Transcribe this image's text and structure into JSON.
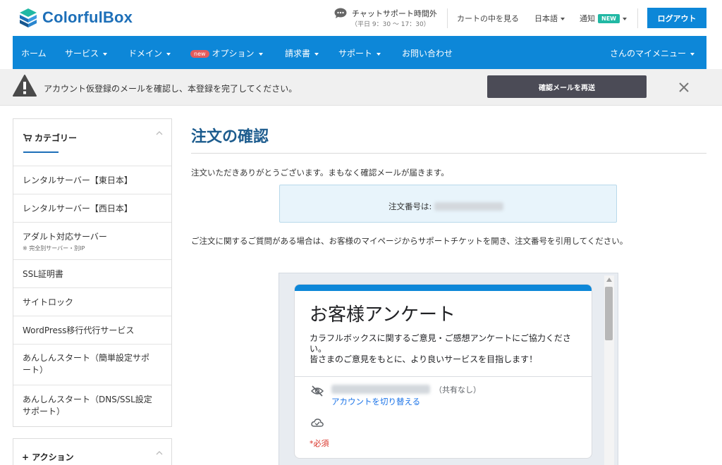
{
  "header": {
    "logo_text": "ColorfulBox",
    "chat_main": "チャットサポート時間外",
    "chat_sub": "（平日 9：30 〜 17：30）",
    "cart_link": "カートの中を見る",
    "language": "日本語",
    "notify": "通知",
    "notify_badge": "NEW",
    "logout": "ログアウト"
  },
  "nav": {
    "home": "ホーム",
    "service": "サービス",
    "domain": "ドメイン",
    "option_badge": "new",
    "option": "オプション",
    "invoice": "請求書",
    "support": "サポート",
    "contact": "お問い合わせ",
    "my_menu": "さんのマイメニュー"
  },
  "alert": {
    "text": "アカウント仮登録のメールを確認し、本登録を完了してください。",
    "resend_button": "確認メールを再送"
  },
  "sidebar": {
    "category_title": "カテゴリー",
    "items": [
      {
        "label": "レンタルサーバー【東日本】"
      },
      {
        "label": "レンタルサーバー【西日本】"
      },
      {
        "label": "アダルト対応サーバー",
        "note": "※ 完全別サーバー・別IP"
      },
      {
        "label": "SSL証明書"
      },
      {
        "label": "サイトロック"
      },
      {
        "label": "WordPress移行代行サービス"
      },
      {
        "label": "あんしんスタート（簡単設定サポ",
        "label2": "ート）"
      },
      {
        "label": "あんしんスタート（DNS/SSL設定",
        "label2": "サポート）"
      }
    ],
    "action_title": "+ アクション"
  },
  "main": {
    "title": "注文の確認",
    "thanks": "注文いただきありがとうございます。まもなく確認メールが届きます。",
    "order_label": "注文番号は:",
    "help": "ご注文に関するご質問がある場合は、お客様のマイページからサポートチケットを開き、注文番号を引用してください。"
  },
  "survey": {
    "title": "お客様アンケート",
    "desc1": "カラフルボックスに関するご意見・ご感想アンケートにご協力ください。",
    "desc2": "皆さまのご意見をもとに、より良いサービスを目指します！",
    "share_note": "（共有なし）",
    "switch_account": "アカウントを切り替える",
    "required": "*必須"
  },
  "colors": {
    "brand_blue": "#0d87d8",
    "title_blue": "#1d5c8e",
    "new_badge": "#21b8a4",
    "alert_button": "#4b4b56",
    "required_red": "#d93025"
  }
}
